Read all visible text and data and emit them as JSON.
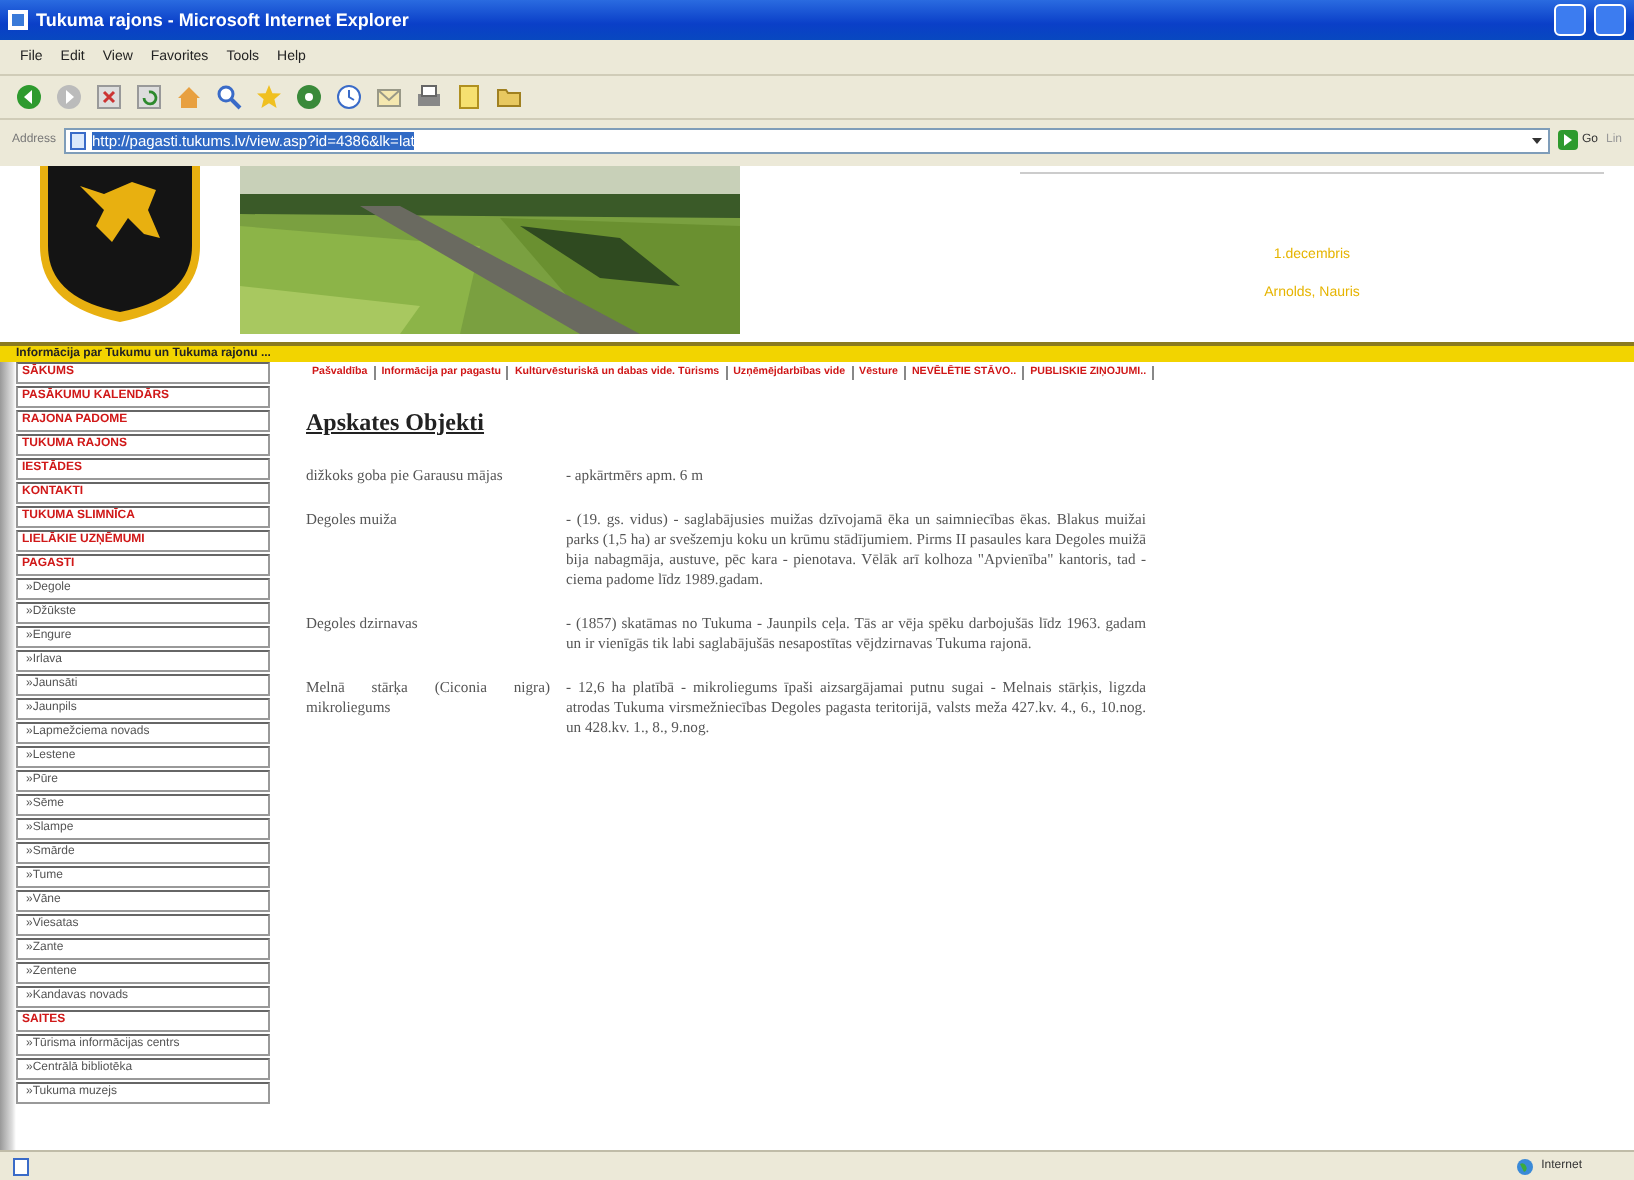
{
  "window": {
    "title": "Tukuma rajons - Microsoft Internet Explorer"
  },
  "menu": [
    "File",
    "Edit",
    "View",
    "Favorites",
    "Tools",
    "Help"
  ],
  "address": {
    "label": "Address",
    "url": "http://pagasti.tukums.lv/view.asp?id=4386&lk=lat",
    "go": "Go",
    "links": "Lin"
  },
  "header": {
    "date": "1.decembris",
    "name_days": "Arnolds, Nauris"
  },
  "info_bar": "Informācija par Tukumu un Tukuma rajonu ...",
  "sidebar": {
    "items": [
      {
        "label": "SĀKUMS",
        "kind": "section"
      },
      {
        "label": "PASĀKUMU KALENDĀRS",
        "kind": "section"
      },
      {
        "label": "RAJONA PADOME",
        "kind": "section"
      },
      {
        "label": "TUKUMA RAJONS",
        "kind": "section"
      },
      {
        "label": "IESTĀDES",
        "kind": "section"
      },
      {
        "label": "KONTAKTI",
        "kind": "section"
      },
      {
        "label": "TUKUMA SLIMNĪCA",
        "kind": "section"
      },
      {
        "label": "LIELĀKIE UZŅĒMUMI",
        "kind": "section"
      },
      {
        "label": "PAGASTI",
        "kind": "section"
      },
      {
        "label": "»Degole",
        "kind": "link"
      },
      {
        "label": "»Džūkste",
        "kind": "link"
      },
      {
        "label": "»Engure",
        "kind": "link"
      },
      {
        "label": "»Irlava",
        "kind": "link"
      },
      {
        "label": "»Jaunsāti",
        "kind": "link"
      },
      {
        "label": "»Jaunpils",
        "kind": "link"
      },
      {
        "label": "»Lapmežciema novads",
        "kind": "link"
      },
      {
        "label": "»Lestene",
        "kind": "link"
      },
      {
        "label": "»Pūre",
        "kind": "link"
      },
      {
        "label": "»Sēme",
        "kind": "link"
      },
      {
        "label": "»Slampe",
        "kind": "link"
      },
      {
        "label": "»Smārde",
        "kind": "link"
      },
      {
        "label": "»Tume",
        "kind": "link"
      },
      {
        "label": "»Vāne",
        "kind": "link"
      },
      {
        "label": "»Viesatas",
        "kind": "link"
      },
      {
        "label": "»Zante",
        "kind": "link"
      },
      {
        "label": "»Zentene",
        "kind": "link"
      },
      {
        "label": "»Kandavas novads",
        "kind": "link"
      },
      {
        "label": "SAITES",
        "kind": "section"
      },
      {
        "label": "»Tūrisma informācijas centrs",
        "kind": "link"
      },
      {
        "label": "»Centrālā bibliotēka",
        "kind": "link"
      },
      {
        "label": "»Tukuma muzejs",
        "kind": "link"
      }
    ]
  },
  "nav": [
    "Pašvaldība",
    "Informācija par pagastu",
    "Kultūrvēsturiskā un dabas vide. Tūrisms",
    "Uzņēmējdarbības vide",
    "Vēsture",
    "NEVĒLĒTIE STĀVO..",
    "PUBLISKIE ZIŅOJUMI.."
  ],
  "content": {
    "title": "Apskates Objekti",
    "rows": [
      {
        "name": "dižkoks goba pie Garausu mājas",
        "description": "- apkārtmērs apm. 6 m"
      },
      {
        "name": "Degoles muiža",
        "description": "- (19. gs. vidus) - saglabājusies muižas dzīvojamā ēka un saimniecības ēkas. Blakus muižai parks (1,5 ha) ar svešzemju koku un krūmu stādījumiem. Pirms II pasaules kara Degoles muižā bija nabagmāja, austuve, pēc kara - pienotava. Vēlāk arī kolhoza \"Apvienība\" kantoris, tad - ciema padome līdz 1989.gadam."
      },
      {
        "name": "Degoles dzirnavas",
        "description": "- (1857) skatāmas no Tukuma - Jaunpils ceļa. Tās ar vēja spēku darbojušās līdz 1963. gadam un ir vienīgās tik labi saglabājušās nesapostītas vējdzirnavas Tukuma rajonā."
      },
      {
        "name": "Melnā stārķa (Ciconia nigra) mikroliegums",
        "description": "- 12,6 ha platībā - mikroliegums īpaši aizsargājamai putnu sugai - Melnais stārķis, ligzda atrodas Tukuma virsmežniecības Degoles pagasta teritorijā, valsts meža 427.kv. 4., 6., 10.nog. un 428.kv. 1., 8., 9.nog."
      }
    ]
  },
  "status_bar": {
    "zone": "Internet"
  }
}
